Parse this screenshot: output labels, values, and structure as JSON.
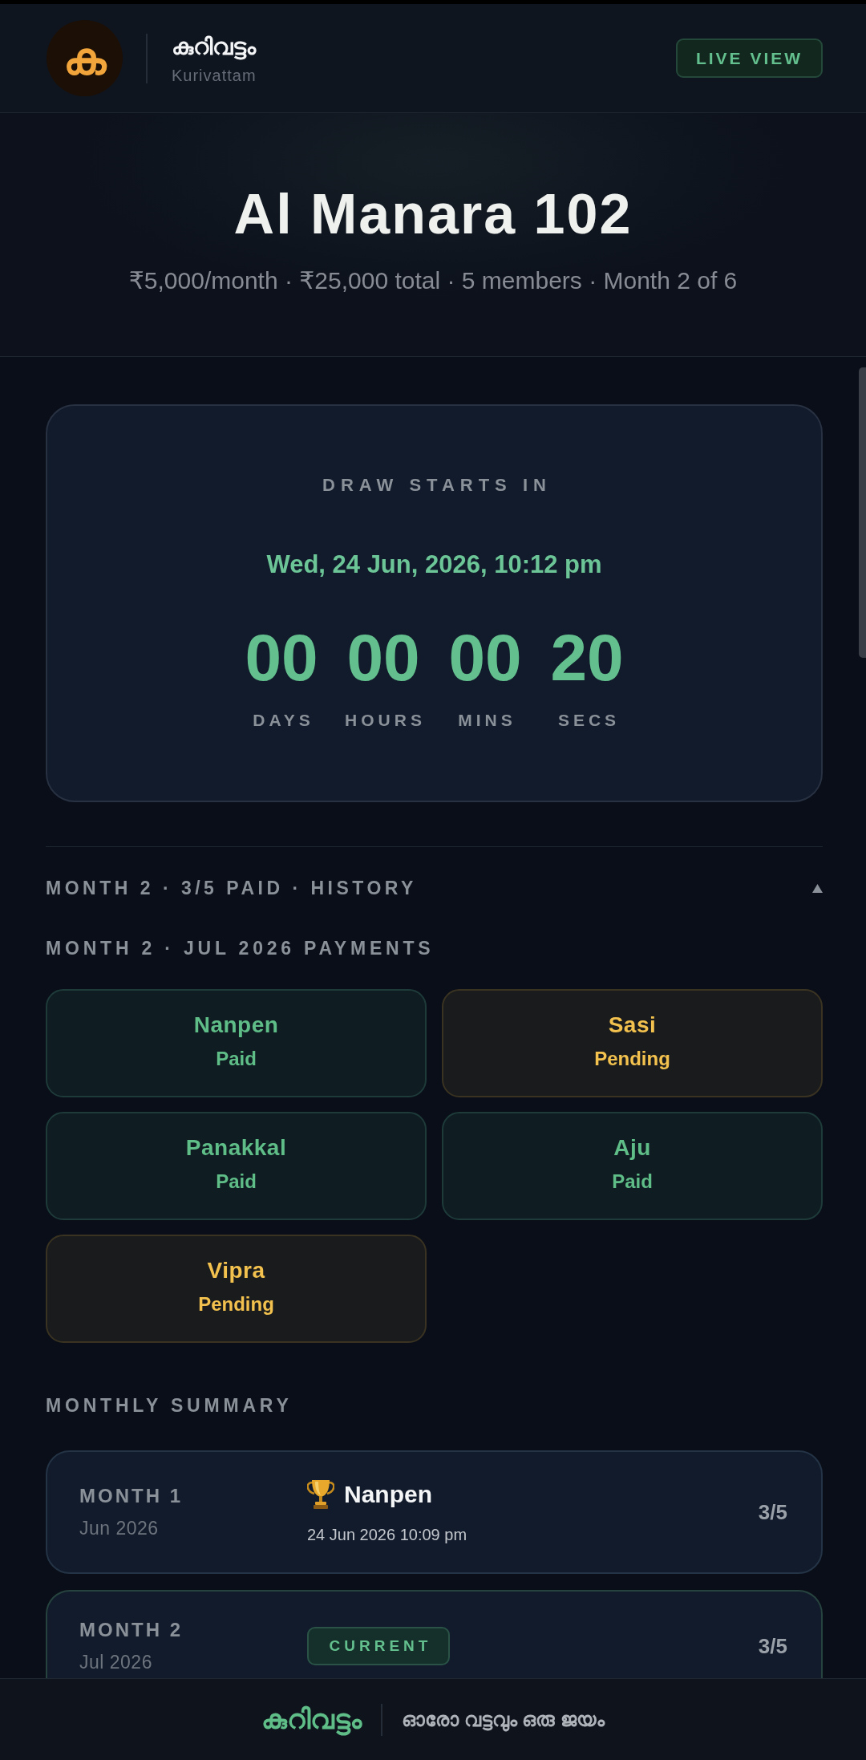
{
  "header": {
    "logo": "ക",
    "title": "കുറിവട്ടം",
    "subtitle": "Kurivattam",
    "live_button": "LIVE VIEW"
  },
  "hero": {
    "title": "Al Manara 102",
    "meta": "₹5,000/month · ₹25,000 total · 5 members · Month 2 of 6"
  },
  "countdown": {
    "label": "DRAW STARTS IN",
    "date": "Wed, 24 Jun, 2026, 10:12 pm",
    "units": [
      {
        "value": "00",
        "label": "DAYS"
      },
      {
        "value": "00",
        "label": "HOURS"
      },
      {
        "value": "00",
        "label": "MINS"
      },
      {
        "value": "20",
        "label": "SECS"
      }
    ]
  },
  "history": {
    "label": "MONTH 2 · 3/5 PAID · HISTORY",
    "expanded": true
  },
  "payments": {
    "title": "MONTH 2 · JUL 2026 PAYMENTS",
    "members": [
      {
        "name": "Nanpen",
        "status": "Paid",
        "kind": "paid"
      },
      {
        "name": "Sasi",
        "status": "Pending",
        "kind": "pending"
      },
      {
        "name": "Panakkal",
        "status": "Paid",
        "kind": "paid"
      },
      {
        "name": "Aju",
        "status": "Paid",
        "kind": "paid"
      },
      {
        "name": "Vipra",
        "status": "Pending",
        "kind": "pending"
      }
    ]
  },
  "summary": {
    "title": "MONTHLY SUMMARY",
    "months": [
      {
        "kind": "drawn",
        "month": "MONTH 1",
        "date": "Jun 2026",
        "winner": "Nanpen",
        "drawn_at": "24 Jun 2026 10:09 pm",
        "paid": "3/5"
      },
      {
        "kind": "current",
        "month": "MONTH 2",
        "date": "Jul 2026",
        "badge": "CURRENT",
        "paid": "3/5"
      }
    ]
  },
  "footer": {
    "brand": "കുറിവട്ടം",
    "tagline": "ഓരോ വട്ടവും ഒരു ജയം"
  }
}
